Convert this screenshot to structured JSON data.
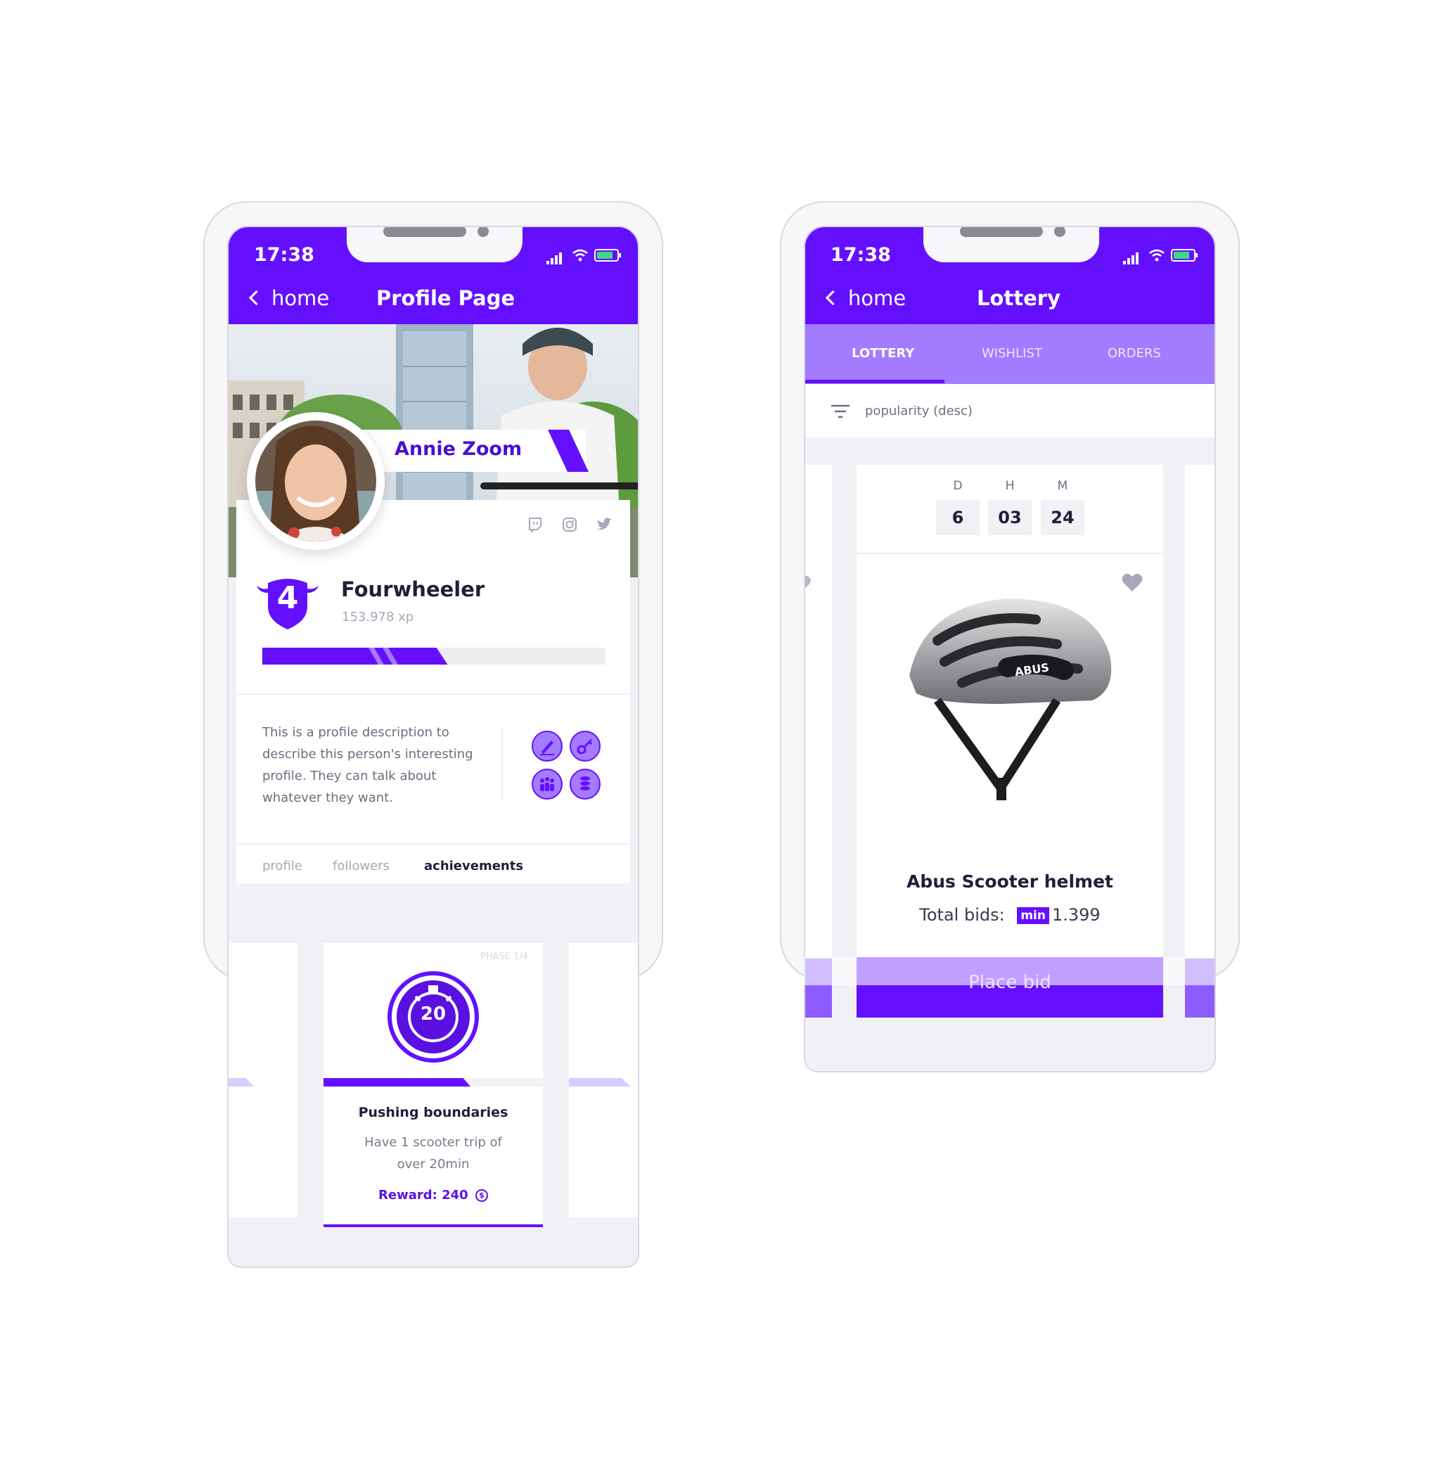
{
  "status": {
    "time": "17:38"
  },
  "profile_screen": {
    "nav": {
      "back_label": "home",
      "title": "Profile Page"
    },
    "user_name": "Annie Zoom",
    "level_number": "4",
    "level_title": "Fourwheeler",
    "xp": "153.978 xp",
    "xp_progress": 0.54,
    "description": "This is a profile description to describe this person's interesting profile. They can talk about whatever they want.",
    "tabs": [
      {
        "label": "profile",
        "active": false
      },
      {
        "label": "followers",
        "active": false
      },
      {
        "label": "achievements",
        "active": true
      }
    ],
    "social_icons": [
      "twitch-icon",
      "instagram-icon",
      "twitter-icon"
    ],
    "badges": [
      "pen-badge-icon",
      "key-badge-icon",
      "group-badge-icon",
      "coins-badge-icon"
    ]
  },
  "achievement_card": {
    "phase_label": "PHASE 1/4",
    "timer_value": "20",
    "title": "Pushing boundaries",
    "desc": "Have 1 scooter trip of over 20min",
    "reward_label": "Reward: 240",
    "progress": 0.67
  },
  "lottery_screen": {
    "nav": {
      "back_label": "home",
      "title": "Lottery"
    },
    "tabs": [
      {
        "label": "LOTTERY",
        "active": true
      },
      {
        "label": "WISHLIST",
        "active": false
      },
      {
        "label": "ORDERS",
        "active": false
      }
    ],
    "sort_label": "popularity (desc)",
    "countdown": {
      "d_label": "D",
      "h_label": "H",
      "m_label": "M",
      "d_value": "6",
      "h_value": "03",
      "m_value": "24"
    },
    "product_name": "Abus Scooter helmet",
    "bids_label": "Total bids:",
    "min_badge": "min",
    "bids_value": "1.399",
    "place_bid_label": "Place bid",
    "helmet_brand": "ABUS"
  },
  "colors": {
    "primary": "#6410ff",
    "primary_light": "#a27bff",
    "muted": "#a7a7b8",
    "dark": "#1f1f3a",
    "battery": "#3ddc84"
  }
}
